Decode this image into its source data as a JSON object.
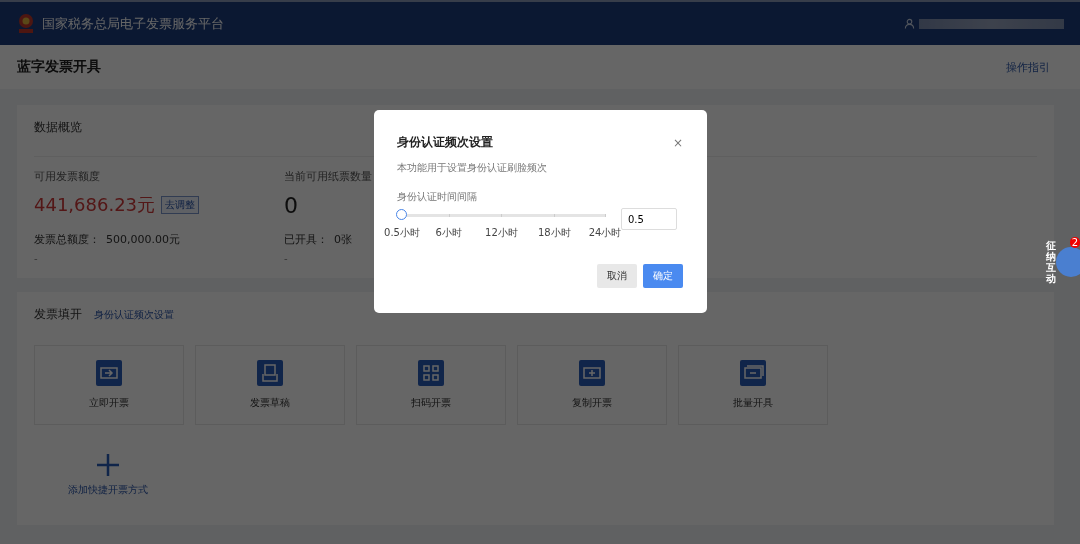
{
  "header": {
    "title": "国家税务总局电子发票服务平台"
  },
  "page": {
    "title": "蓝字发票开具",
    "guide_link": "操作指引"
  },
  "overview": {
    "title": "数据概览",
    "stats": [
      {
        "label": "可用发票额度",
        "value": "441,686.23元",
        "action": "去调整",
        "sub_label": "发票总额度：",
        "sub_value": "500,000.00元",
        "note": "-"
      },
      {
        "label": "当前可用纸票数量",
        "value": "0",
        "sub_label": "已开具：",
        "sub_value": "0张",
        "note": "-"
      }
    ]
  },
  "invoice_fill": {
    "title": "发票填开",
    "link": "身份认证频次设置",
    "actions": [
      {
        "label": "立即开票"
      },
      {
        "label": "发票草稿"
      },
      {
        "label": "扫码开票"
      },
      {
        "label": "复制开票"
      },
      {
        "label": "批量开具"
      }
    ],
    "add_label": "添加快捷开票方式"
  },
  "chat_widget": {
    "label": "征纳互动",
    "badge": "2"
  },
  "dialog": {
    "title": "身份认证频次设置",
    "close": "×",
    "description": "本功能用于设置身份认证刷脸频次",
    "field_label": "身份认证时间间隔",
    "slider": {
      "level": 0,
      "ticks": [
        {
          "label": "0.5小时"
        },
        {
          "label": "6小时"
        },
        {
          "label": "12小时"
        },
        {
          "label": "18小时"
        },
        {
          "label": "24小时"
        }
      ]
    },
    "value": "0.5",
    "buttons": [
      {
        "label": "取消",
        "kind": "secondary"
      },
      {
        "label": "确定",
        "kind": "primary"
      }
    ]
  }
}
